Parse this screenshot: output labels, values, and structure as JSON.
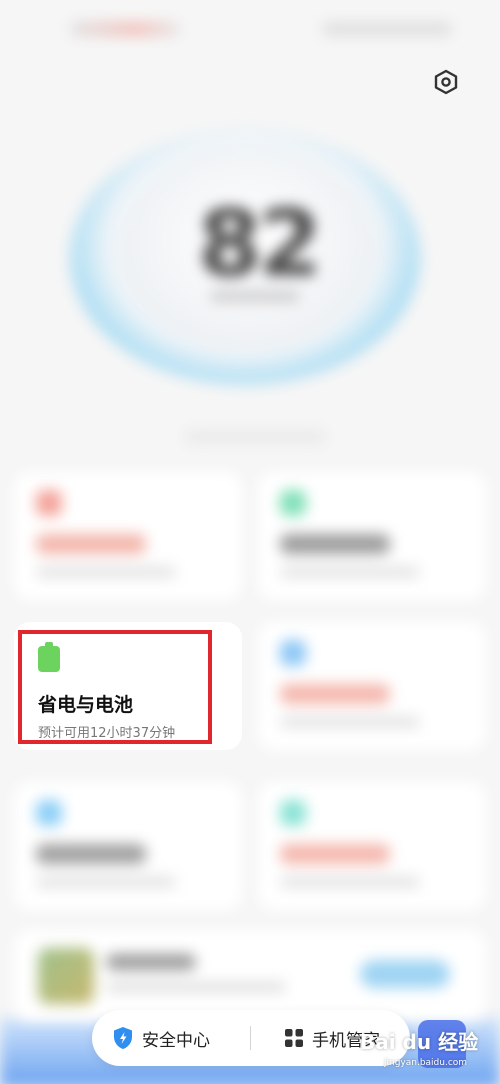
{
  "status": {
    "left": "",
    "right": ""
  },
  "score": {
    "value": "",
    "subtitle": ""
  },
  "cards": [
    {
      "id": "memory",
      "title": "",
      "subtitle": ""
    },
    {
      "id": "storage",
      "title": "",
      "subtitle": ""
    },
    {
      "id": "battery",
      "title": "省电与电池",
      "subtitle": "预计可用12小时37分钟"
    },
    {
      "id": "traffic",
      "title": "",
      "subtitle": ""
    },
    {
      "id": "virus",
      "title": "",
      "subtitle": ""
    },
    {
      "id": "deep-clean",
      "title": "",
      "subtitle": ""
    }
  ],
  "bottom_nav": {
    "security_center": "安全中心",
    "phone_manager": "手机管家"
  },
  "watermark": {
    "brand": "Bai du 经验",
    "url": "jingyan.baidu.com"
  },
  "colors": {
    "battery_green": "#6bd35e",
    "highlight_red": "#e0272d",
    "shield_blue": "#2f8ef0"
  }
}
